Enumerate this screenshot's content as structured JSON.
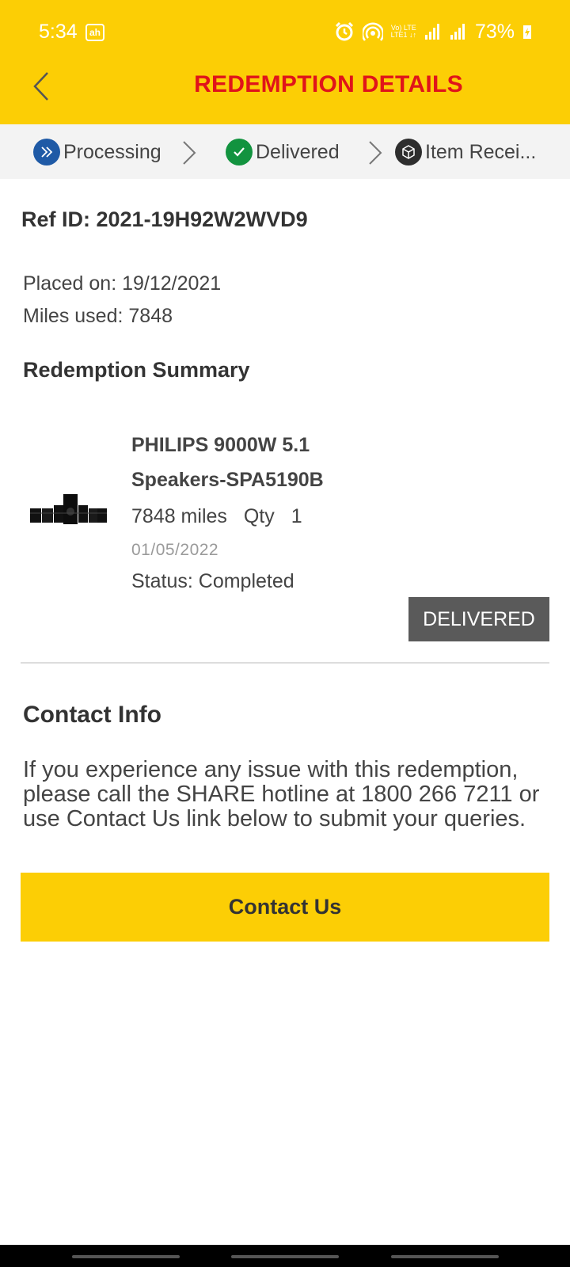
{
  "status_bar": {
    "time": "5:34",
    "app_badge": "ah",
    "net_top": "Vo) LTE",
    "net_bottom": "LTE1 ↓↑",
    "battery": "73%"
  },
  "header": {
    "title": "REDEMPTION DETAILS",
    "back_icon": "chevron-left-icon"
  },
  "progress": {
    "steps": [
      {
        "label": "Processing",
        "icon": "double-chevron-right-icon",
        "color": "#1F5AA6"
      },
      {
        "label": "Delivered",
        "icon": "check-icon",
        "color": "#12933F"
      },
      {
        "label": "Item Recei...",
        "icon": "box-icon",
        "color": "#2E2E2E"
      }
    ]
  },
  "order": {
    "ref_id": "Ref ID: 2021-19H92W2WVD9",
    "placed_on": "Placed on: 19/12/2021",
    "miles_used": "Miles used: 7848"
  },
  "summary": {
    "title": "Redemption Summary",
    "item": {
      "name_line1": "PHILIPS 9000W 5.1",
      "name_line2": "Speakers-SPA5190B",
      "miles": "7848 miles",
      "qty_label": "Qty",
      "qty": "1",
      "date": "01/05/2022",
      "status": "Status: Completed",
      "badge": "DELIVERED"
    }
  },
  "contact": {
    "title": "Contact Info",
    "body": "If you experience any issue with this redemption, please call the SHARE hotline at 1800 266 7211 or use Contact Us link below to submit your queries.",
    "button": "Contact Us"
  },
  "colors": {
    "brand_yellow": "#FCCE05",
    "title_red": "#E0141A",
    "badge_grey": "#5A5A5A"
  }
}
